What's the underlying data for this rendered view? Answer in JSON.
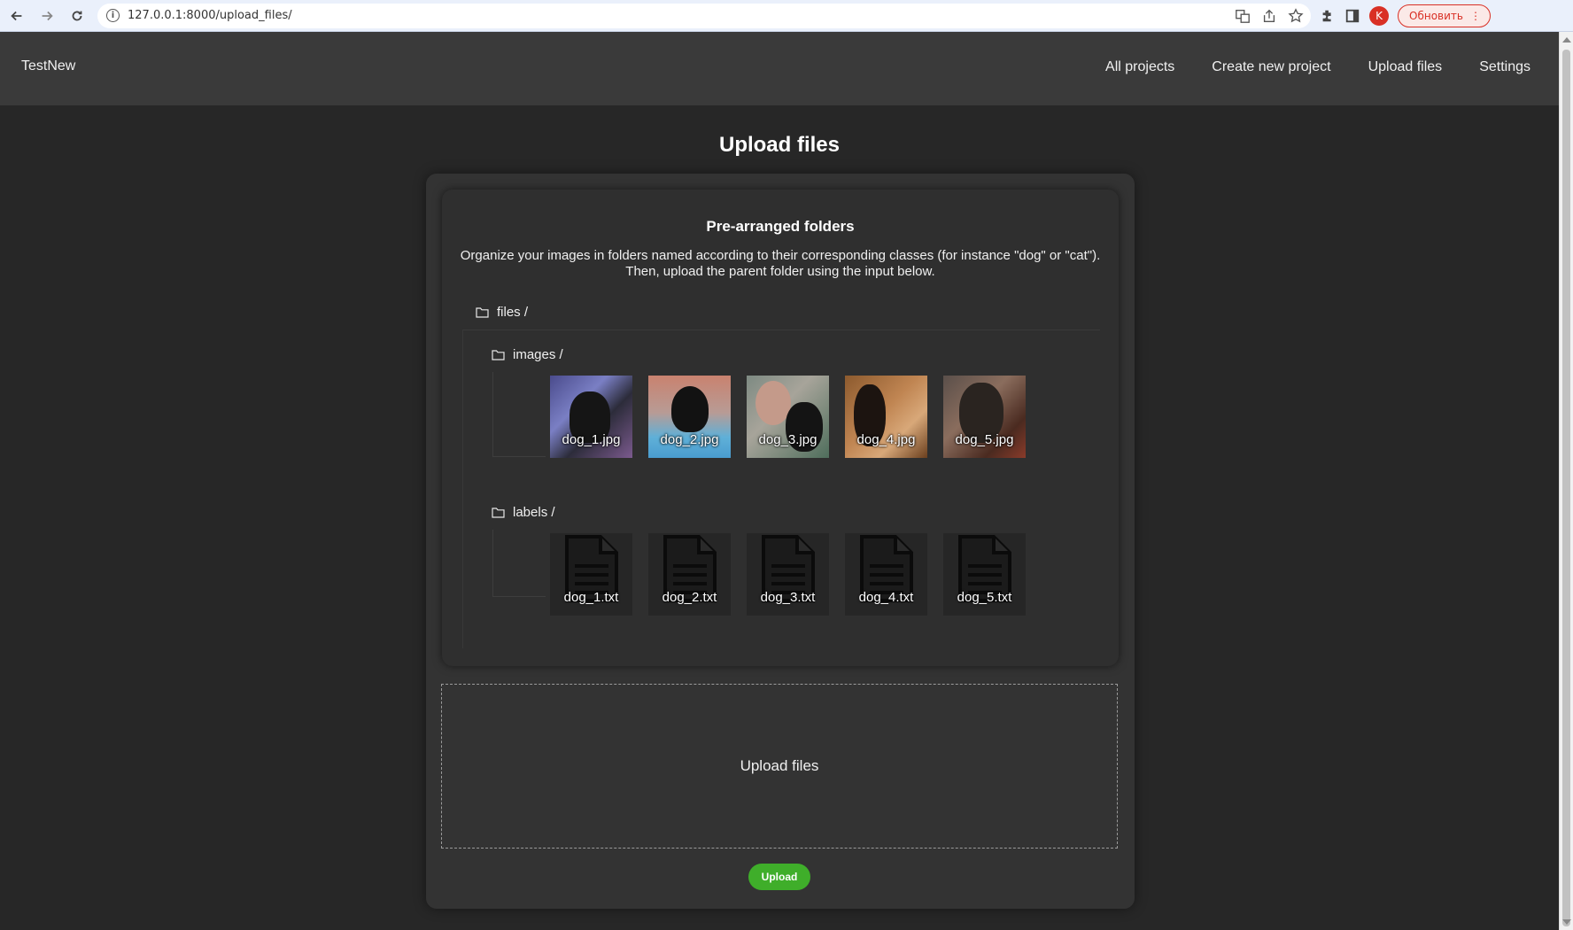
{
  "browser": {
    "url": "127.0.0.1:8000/upload_files/",
    "profile_initial": "K",
    "update_label": "Обновить"
  },
  "navbar": {
    "brand": "TestNew",
    "links": [
      "All projects",
      "Create new project",
      "Upload files",
      "Settings"
    ]
  },
  "page": {
    "title": "Upload files",
    "section_title": "Pre-arranged folders",
    "description_line1": "Organize your images in folders named according to their corresponding classes (for instance \"dog\" or \"cat\").",
    "description_line2": "Then, upload the parent folder using the input below."
  },
  "tree": {
    "root": "files /",
    "images_folder": "images /",
    "labels_folder": "labels /",
    "images": [
      "dog_1.jpg",
      "dog_2.jpg",
      "dog_3.jpg",
      "dog_4.jpg",
      "dog_5.jpg"
    ],
    "labels": [
      "dog_1.txt",
      "dog_2.txt",
      "dog_3.txt",
      "dog_4.txt",
      "dog_5.txt"
    ]
  },
  "dropzone": {
    "label": "Upload files"
  },
  "upload_button": {
    "label": "Upload",
    "color": "#3fae2a"
  }
}
